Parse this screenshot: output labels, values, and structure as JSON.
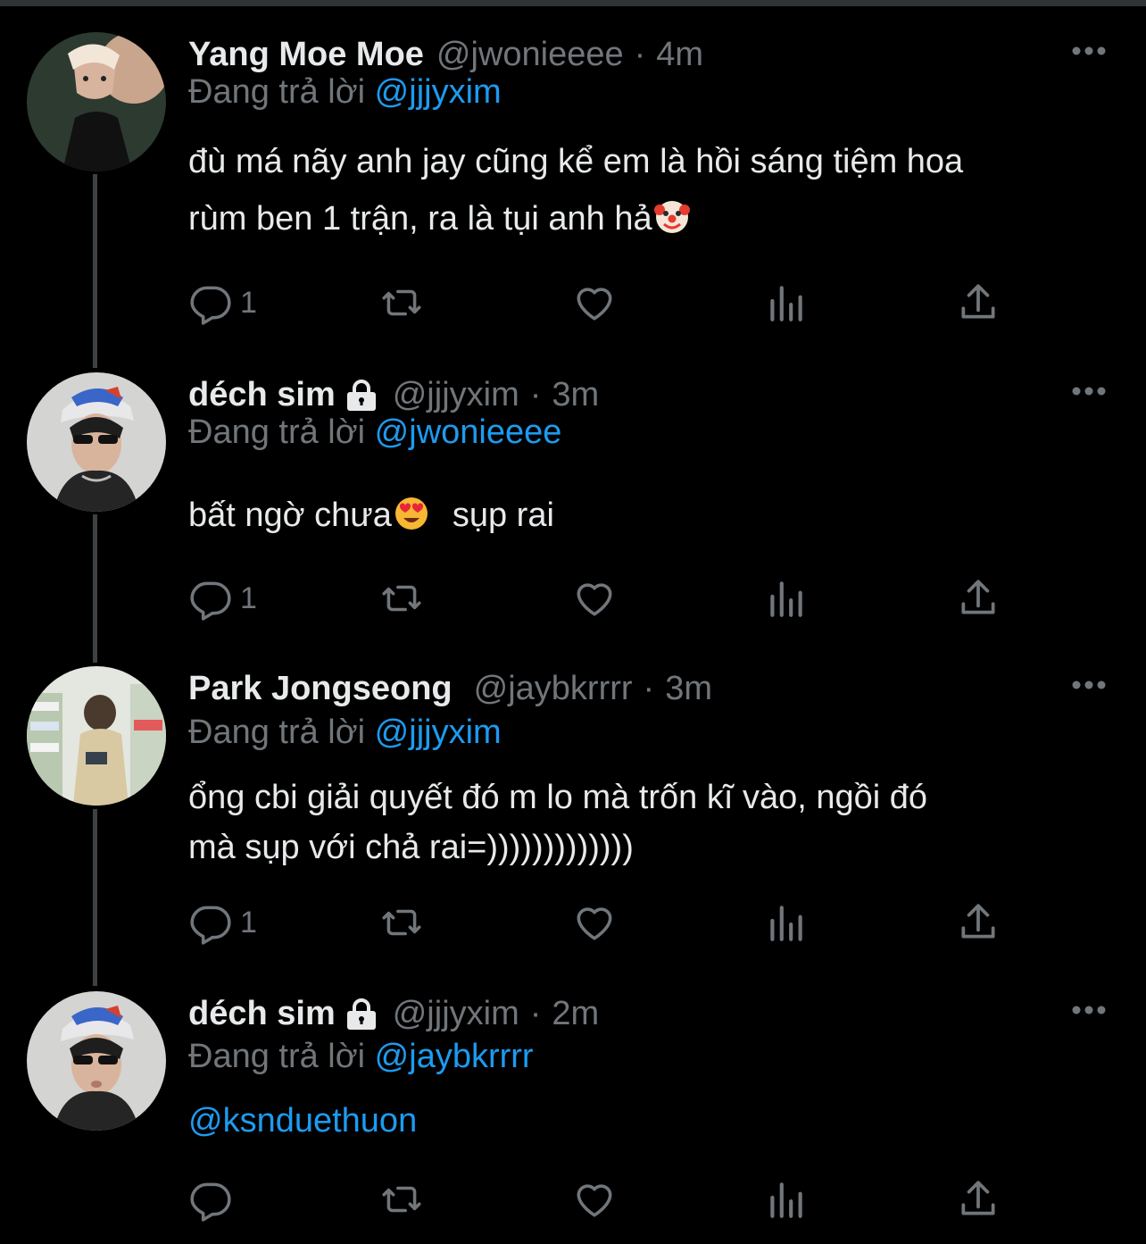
{
  "tweets": [
    {
      "name": "Yang Moe Moe",
      "protected": false,
      "handle": "@jwonieeee",
      "separator": "·",
      "time": "4m",
      "reply_prefix": "Đang trả lời",
      "reply_to": "@jjjyxim",
      "text_lines": [
        "đù má nãy anh jay cũng kể em là hồi sáng tiệm hoa",
        "rùm ben 1 trận, ra là tụi anh hả"
      ],
      "emoji": "clown-face-emoji",
      "reply_count": "1"
    },
    {
      "name": "déch sim",
      "protected": true,
      "handle": "@jjjyxim",
      "separator": "·",
      "time": "3m",
      "reply_prefix": "Đang trả lời",
      "reply_to": "@jwonieeee",
      "text_before_emoji": "bất ngờ chưa",
      "emoji": "heart-eyes-emoji",
      "text_after_emoji": "sụp rai",
      "reply_count": "1"
    },
    {
      "name": "Park Jongseong",
      "protected": false,
      "handle": "@jaybkrrrr",
      "separator": "·",
      "time": "3m",
      "reply_prefix": "Đang trả lời",
      "reply_to": "@jjjyxim",
      "text_lines": [
        "ổng cbi giải quyết đó m lo mà trốn kĩ vào, ngồi đó",
        "mà sụp với chả rai=)))))))))))))"
      ],
      "reply_count": "1"
    },
    {
      "name": "déch sim",
      "protected": true,
      "handle": "@jjjyxim",
      "separator": "·",
      "time": "2m",
      "reply_prefix": "Đang trả lời",
      "reply_to": "@jaybkrrrr",
      "mention_text": "@ksnduethuon",
      "reply_count": ""
    }
  ],
  "icons": {
    "reply": "reply-icon",
    "retweet": "retweet-icon",
    "like": "like-icon",
    "views": "views-icon",
    "share": "share-icon",
    "more": "more-icon",
    "lock": "lock-icon"
  },
  "colors": {
    "background": "#000000",
    "text": "#e7e9ea",
    "secondary": "#71767b",
    "link": "#1d9bf0",
    "thread_line": "#3e4144"
  }
}
